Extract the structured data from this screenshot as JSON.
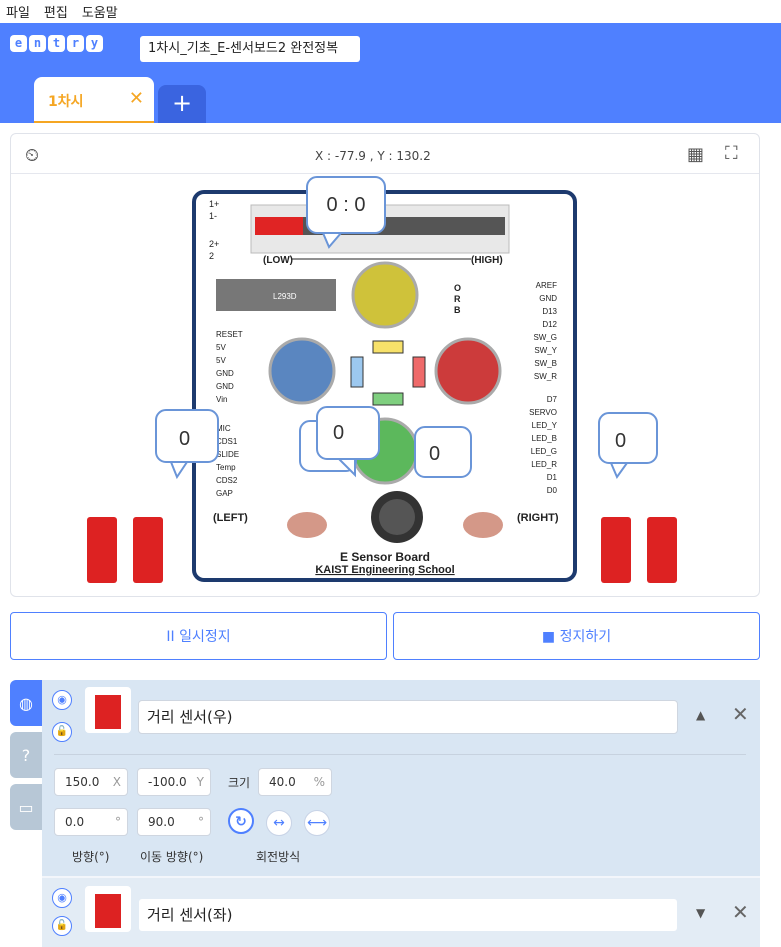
{
  "menu": [
    "파일",
    "편집",
    "도움말"
  ],
  "logo_letters": [
    "e",
    "n",
    "t",
    "r",
    "y"
  ],
  "project_title": "1차시_기초_E-센서보드2 완전정복",
  "scene_tab": {
    "label": "1차시",
    "close": "✕",
    "add": "+"
  },
  "stage": {
    "coord": "X : -77.9 , Y : 130.2",
    "board_title": "E Sensor Board",
    "board_subtitle": "KAIST Engineering School",
    "bubbles": {
      "top": "0 : 0",
      "left": "0",
      "mid_left": "0",
      "mid_center": "0",
      "mid_right": "0",
      "right": "0"
    },
    "labels": {
      "low": "(LOW)",
      "high": "(HIGH)",
      "left": "(LEFT)",
      "right": "(RIGHT)",
      "chip": "L293D",
      "one_plus": "1+",
      "one_minus": "1-",
      "two_plus": "2+",
      "two": "2",
      "o": "O",
      "r": "R",
      "b": "B",
      "left_pins": [
        "RESET",
        "5V",
        "5V",
        "GND",
        "GND",
        "Vin"
      ],
      "left_pins2": [
        "MIC",
        "CDS1",
        "SLIDE",
        "Temp",
        "CDS2",
        "GAP"
      ],
      "right_pins": [
        "AREF",
        "GND",
        "D13",
        "D12",
        "SW_G",
        "SW_Y",
        "SW_B",
        "SW_R"
      ],
      "right_pins2": [
        "D7",
        "SERVO",
        "LED_Y",
        "LED_B",
        "LED_G",
        "LED_R",
        "D1",
        "D0"
      ]
    }
  },
  "controls": {
    "pause": "II 일시정지",
    "stop": "■ 정지하기"
  },
  "side_tabs": [
    "object-tab",
    "help-tab",
    "console-tab"
  ],
  "objects": [
    {
      "name": "거리 센서(우)",
      "x": "150.0",
      "x_unit": "X",
      "y": "-100.0",
      "y_unit": "Y",
      "size_label": "크기",
      "size": "40.0",
      "size_unit": "%",
      "direction": "0.0",
      "direction_unit": "°",
      "move_direction": "90.0",
      "move_direction_unit": "°",
      "direction_label": "방향(°)",
      "move_label": "이동 방향(°)",
      "rotate_label": "회전방식"
    },
    {
      "name": "거리 센서(좌)"
    }
  ],
  "colors": {
    "accent": "#4f80ff",
    "tab": "#f5a623"
  }
}
